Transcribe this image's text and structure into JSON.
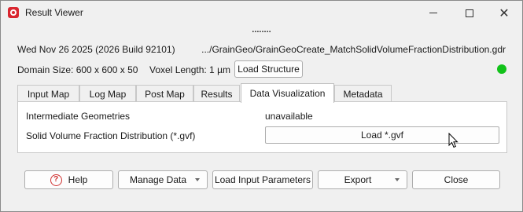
{
  "window": {
    "title": "Result Viewer",
    "splitter_handle": "........"
  },
  "info": {
    "timestamp": "Wed Nov 26 2025 (2026 Build 92101)",
    "file_path": ".../GrainGeo/GrainGeoCreate_MatchSolidVolumeFractionDistribution.gdr",
    "domain_size": "Domain Size: 600 x 600 x 50",
    "voxel_length": "Voxel Length: 1 µm",
    "load_structure_label": "Load Structure",
    "status_color": "#12c21a"
  },
  "tabs": [
    {
      "label": "Input Map",
      "active": false
    },
    {
      "label": "Log Map",
      "active": false
    },
    {
      "label": "Post Map",
      "active": false
    },
    {
      "label": "Results",
      "active": false
    },
    {
      "label": "Data Visualization",
      "active": true
    },
    {
      "label": "Metadata",
      "active": false
    }
  ],
  "panel": {
    "intermediate_label": "Intermediate Geometries",
    "intermediate_value": "unavailable",
    "solid_label": "Solid Volume Fraction Distribution (*.gvf)",
    "load_gvf_label": "Load *.gvf"
  },
  "buttons": {
    "help": "Help",
    "manage_data": "Manage Data",
    "load_input": "Load Input Parameters",
    "export": "Export",
    "close": "Close"
  },
  "icons": {
    "app": "app-logo-icon",
    "help": "help-question-icon",
    "cursor": "mouse-pointer-icon"
  }
}
